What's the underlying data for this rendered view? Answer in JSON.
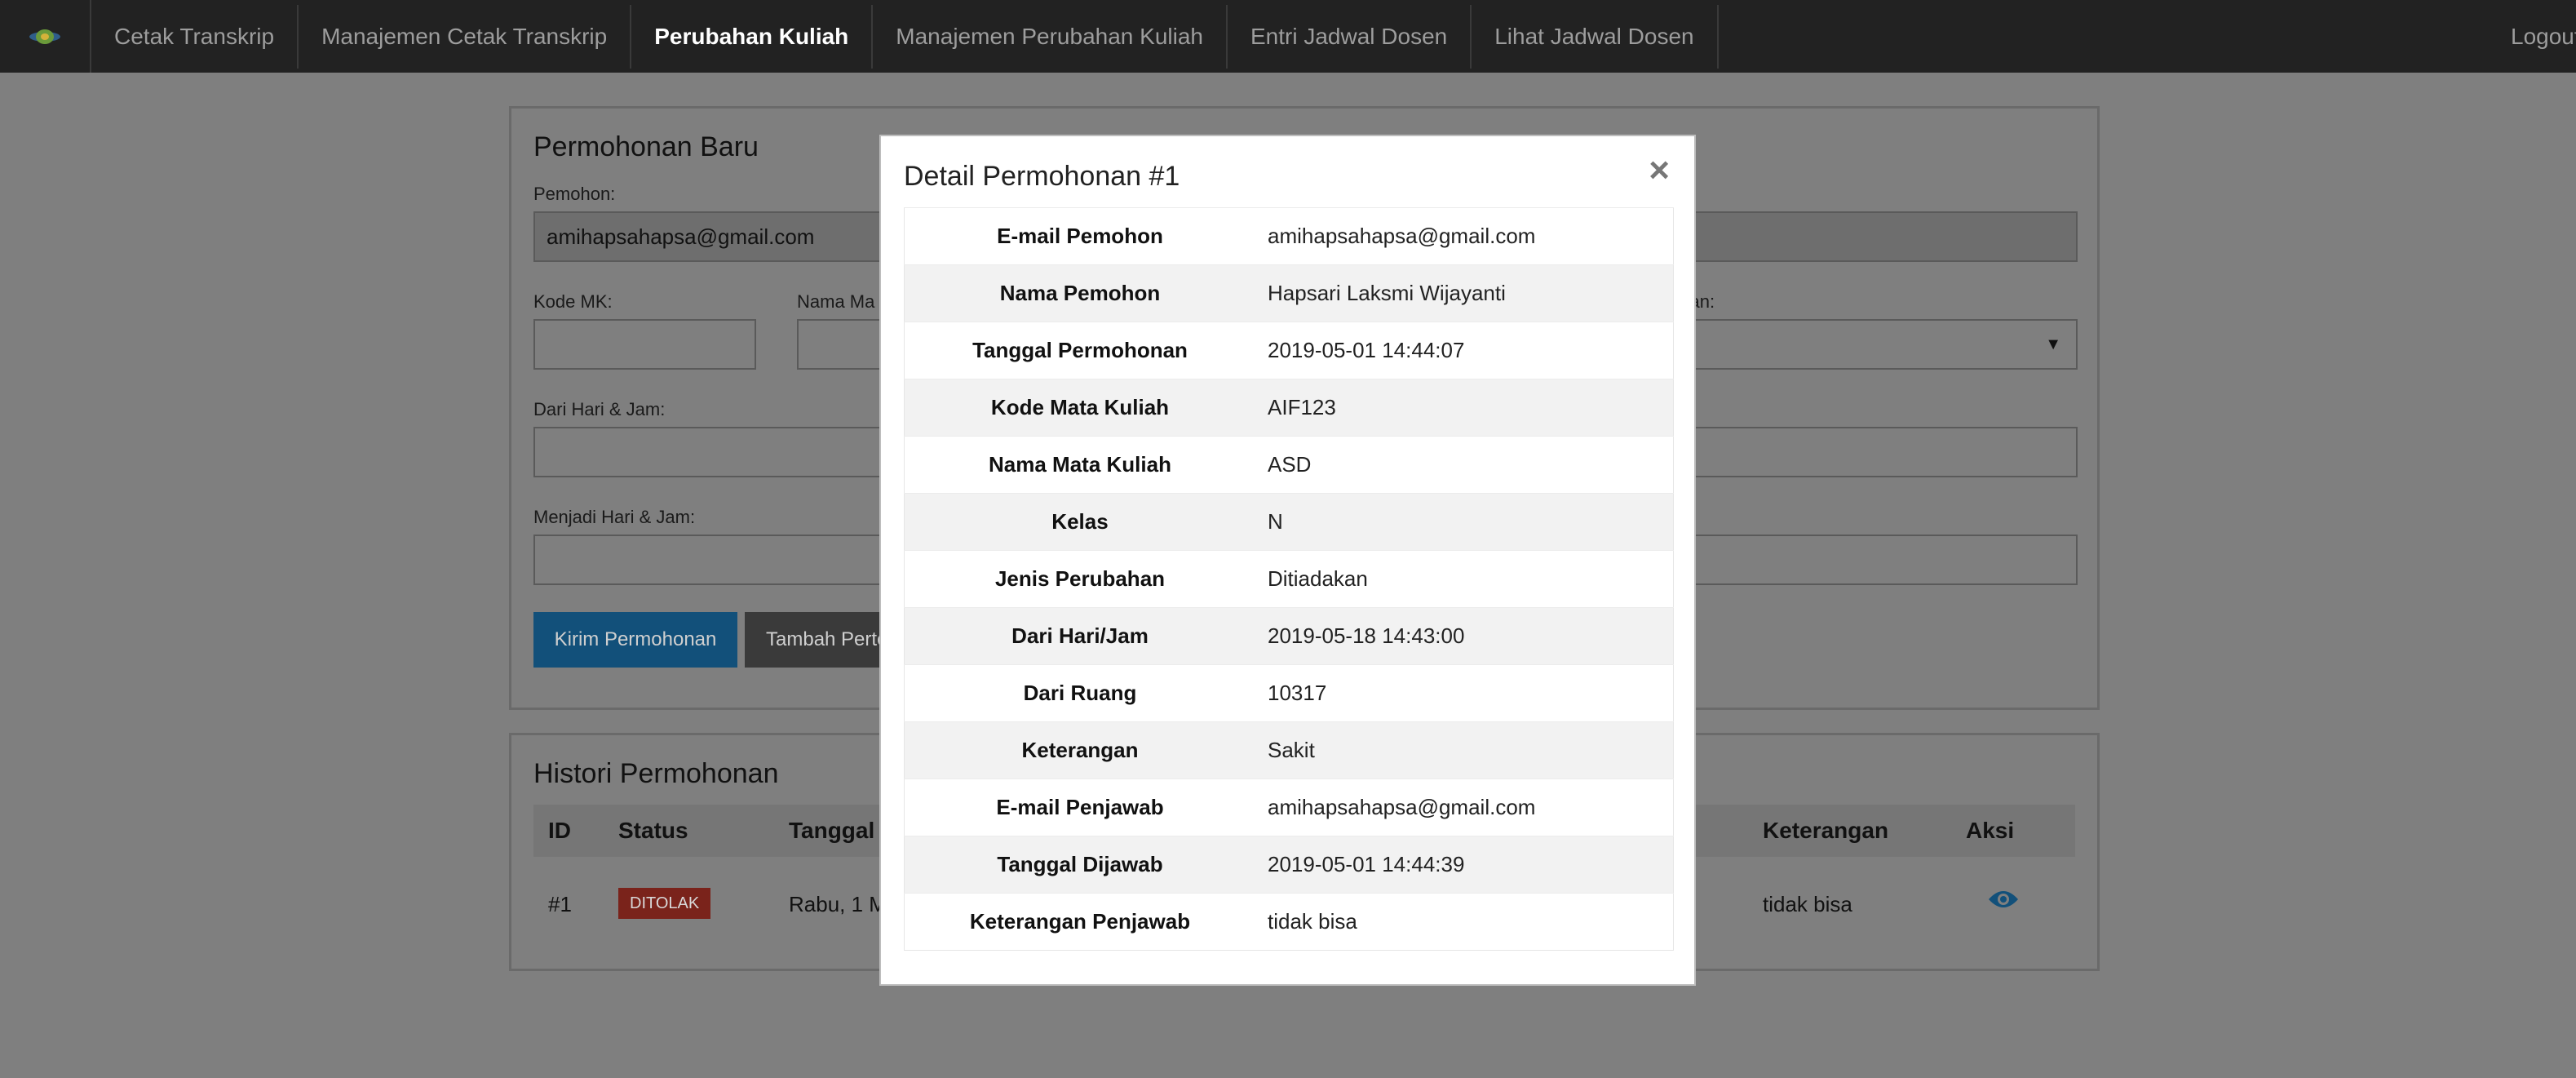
{
  "nav": {
    "items": [
      {
        "label": "Cetak Transkrip",
        "active": false
      },
      {
        "label": "Manajemen Cetak Transkrip",
        "active": false
      },
      {
        "label": "Perubahan Kuliah",
        "active": true
      },
      {
        "label": "Manajemen Perubahan Kuliah",
        "active": false
      },
      {
        "label": "Entri Jadwal Dosen",
        "active": false
      },
      {
        "label": "Lihat Jadwal Dosen",
        "active": false
      }
    ],
    "logout": "Logout"
  },
  "form": {
    "title": "Permohonan Baru",
    "pemohon_label": "Pemohon:",
    "pemohon_value": "amihapsahapsa@gmail.com",
    "kode_label": "Kode MK:",
    "nama_label": "Nama Ma",
    "jenis_label": "ahan:",
    "dari_label": "Dari Hari & Jam:",
    "menjadi_label": "Menjadi Hari & Jam:",
    "submit_label": "Kirim Permohonan",
    "add_label": "Tambah Perte"
  },
  "history": {
    "title": "Histori Permohonan",
    "headers": {
      "id": "ID",
      "status": "Status",
      "tanggal": "Tanggal I",
      "keterangan": "Keterangan",
      "aksi": "Aksi"
    },
    "rows": [
      {
        "id": "#1",
        "status": "DITOLAK",
        "tanggal": "Rabu, 1 M",
        "keterangan": "tidak bisa"
      }
    ]
  },
  "modal": {
    "title": "Detail Permohonan #1",
    "close": "×",
    "rows": [
      {
        "key": "E-mail Pemohon",
        "value": "amihapsahapsa@gmail.com"
      },
      {
        "key": "Nama Pemohon",
        "value": "Hapsari Laksmi Wijayanti"
      },
      {
        "key": "Tanggal Permohonan",
        "value": "2019-05-01 14:44:07"
      },
      {
        "key": "Kode Mata Kuliah",
        "value": "AIF123"
      },
      {
        "key": "Nama Mata Kuliah",
        "value": "ASD"
      },
      {
        "key": "Kelas",
        "value": "N"
      },
      {
        "key": "Jenis Perubahan",
        "value": "Ditiadakan"
      },
      {
        "key": "Dari Hari/Jam",
        "value": "2019-05-18 14:43:00"
      },
      {
        "key": "Dari Ruang",
        "value": "10317"
      },
      {
        "key": "Keterangan",
        "value": "Sakit"
      },
      {
        "key": "E-mail Penjawab",
        "value": "amihapsahapsa@gmail.com"
      },
      {
        "key": "Tanggal Dijawab",
        "value": "2019-05-01 14:44:39"
      },
      {
        "key": "Keterangan Penjawab",
        "value": "tidak bisa"
      }
    ]
  },
  "colors": {
    "badge_status": "#d9534f",
    "primary": "#2a8fd6",
    "overlay": "#7f7f7f"
  }
}
